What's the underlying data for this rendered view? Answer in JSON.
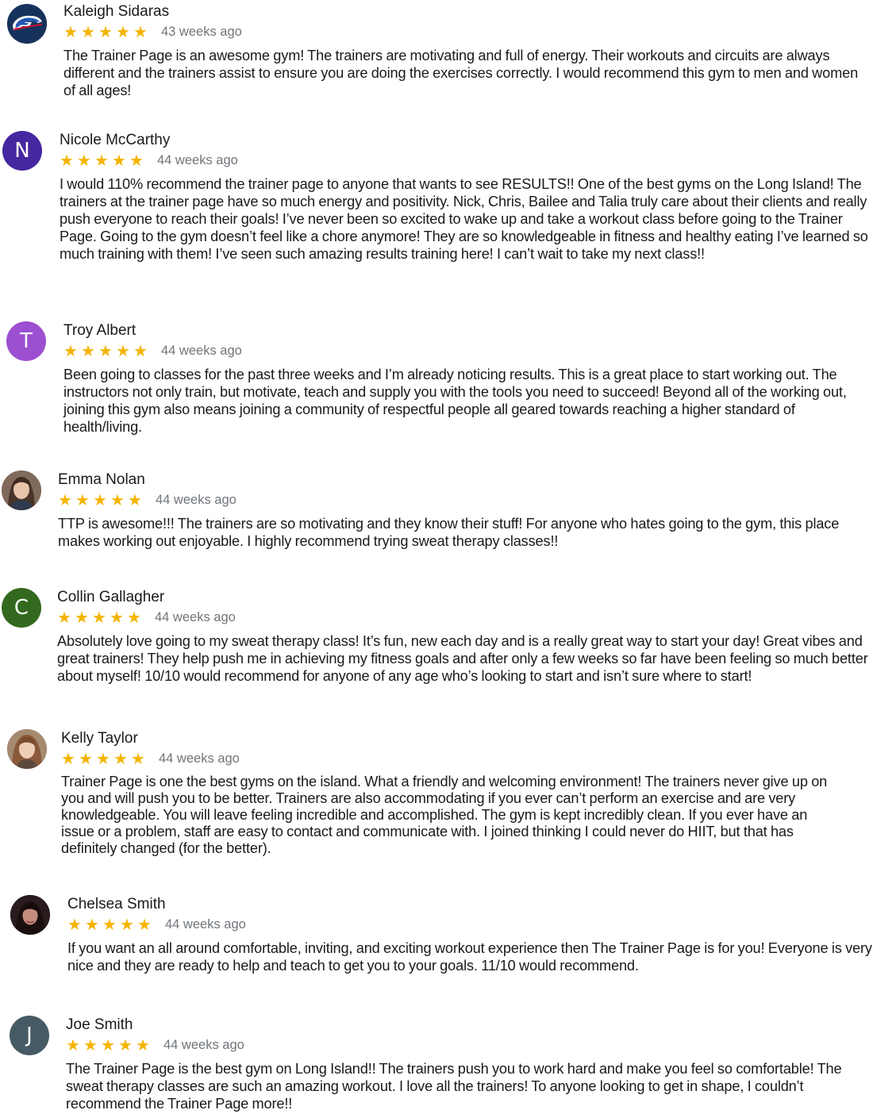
{
  "colors": {
    "star": "#f4b400",
    "meta_text": "#70757a",
    "avatar_n": "#4527a0",
    "avatar_t": "#9c4fd0",
    "avatar_c": "#33691e",
    "avatar_j": "#455a64"
  },
  "reviews": [
    {
      "name": "Kaleigh Sidaras",
      "avatar_icon": "buffalo-logo-icon",
      "rating": 5,
      "time": "43 weeks ago",
      "text": "The Trainer Page is an awesome gym! The trainers are motivating and full of energy. Their workouts and circuits are always different and the trainers assist to ensure you are doing the exercises correctly. I would recommend this gym to men and women of all ages!"
    },
    {
      "name": "Nicole McCarthy",
      "avatar_letter": "N",
      "rating": 5,
      "time": "44 weeks ago",
      "text": "I would 110% recommend the trainer page to anyone that wants to see RESULTS!! One of the best gyms on the Long Island! The trainers at the trainer page have so much energy and positivity. Nick, Chris, Bailee and Talia truly care about their clients and really push everyone to reach their goals! I’ve never been so excited to wake up and take a workout class before going to the Trainer Page. Going to the gym doesn’t feel like a chore anymore! They are so knowledgeable in fitness and healthy eating I’ve learned so much training with them! I’ve seen such amazing results training here! I can’t wait to take my next class!!"
    },
    {
      "name": "Troy Albert",
      "avatar_letter": "T",
      "rating": 5,
      "time": "44 weeks ago",
      "text": "Been going to classes for the past three weeks and I’m already noticing results. This is a great place to start working out. The instructors not only train, but motivate, teach and supply you with the tools you need to succeed! Beyond all of the working out, joining this gym also means joining a community of respectful people all geared towards reaching a higher standard of health/living."
    },
    {
      "name": "Emma Nolan",
      "avatar_icon": "profile-photo-icon",
      "rating": 5,
      "time": "44 weeks ago",
      "text": "TTP is awesome!!! The trainers are so motivating and they know their stuff! For anyone who hates going to the gym, this place makes working out enjoyable. I highly recommend trying sweat therapy classes!!"
    },
    {
      "name": "Collin Gallagher",
      "avatar_letter": "C",
      "rating": 5,
      "time": "44 weeks ago",
      "text": "Absolutely love going to my sweat therapy class! It’s fun, new each day and is a really great way to start your day! Great vibes and great trainers! They help push me in achieving my fitness goals and after only a few weeks so far have been feeling so much better about myself! 10/10 would recommend for anyone of any age who’s looking to start and isn’t sure where to start!"
    },
    {
      "name": "Kelly Taylor",
      "avatar_icon": "profile-photo-icon",
      "rating": 5,
      "time": "44 weeks ago",
      "text": "Trainer Page is one the best gyms on the island. What a friendly and welcoming environment! The trainers never give up on you and will push you to be better. Trainers are also accommodating if you ever can’t perform an exercise and are very knowledgeable. You will leave feeling incredible and accomplished. The gym is kept incredibly clean. If you ever have an issue or a problem, staff are easy to contact and communicate with. I joined thinking I could never do HIIT, but that has definitely changed (for the better)."
    },
    {
      "name": "Chelsea Smith",
      "avatar_icon": "profile-photo-icon",
      "rating": 5,
      "time": "44 weeks ago",
      "text": "If you want an all around comfortable, inviting, and exciting workout experience then The Trainer Page is for you! Everyone is very nice and they are ready to help and teach to get you to your goals. 11/10 would recommend."
    },
    {
      "name": "Joe Smith",
      "avatar_letter": "J",
      "rating": 5,
      "time": "44 weeks ago",
      "text": "The Trainer Page is the best gym on Long Island!! The trainers push you to work hard and make you feel so comfortable! The sweat therapy classes are such an amazing workout. I love all the trainers! To anyone looking to get in shape, I couldn’t recommend the Trainer Page more!!"
    }
  ]
}
